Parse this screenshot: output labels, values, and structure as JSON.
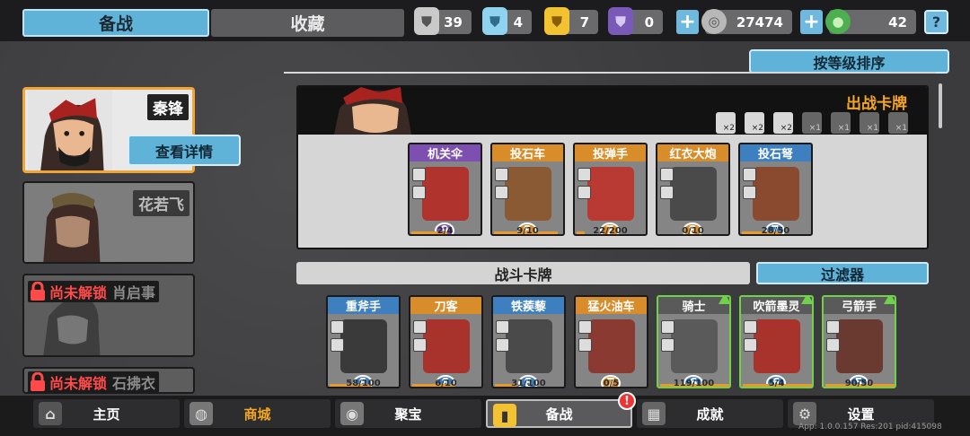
{
  "tabs": {
    "active": "备战",
    "inactive": "收藏"
  },
  "resources": [
    {
      "icon": "silver-shield-icon",
      "value": "39"
    },
    {
      "icon": "crystal-shield-icon",
      "value": "4"
    },
    {
      "icon": "gold-shield-icon",
      "value": "7"
    },
    {
      "icon": "purple-shield-icon",
      "value": "0"
    },
    {
      "icon": "coin-icon",
      "value": "27474"
    },
    {
      "icon": "gem-icon",
      "value": "42"
    }
  ],
  "help_label": "?",
  "sort_button": "按等级排序",
  "heroes": [
    {
      "name": "秦锋",
      "detail_button": "查看详情"
    },
    {
      "name": "花若飞"
    },
    {
      "lock_text": "尚未解锁",
      "name": "肖启事"
    },
    {
      "lock_text": "尚未解锁",
      "name": "石拂衣"
    }
  ],
  "deck": {
    "title": "出战卡牌",
    "tokens": [
      "×2",
      "×2",
      "×2",
      "×1",
      "×1",
      "×1",
      "×1"
    ],
    "cards": [
      {
        "name": "机关伞",
        "level": "9",
        "count": "2/4",
        "fill": 0.5
      },
      {
        "name": "投石车",
        "level": "8",
        "count": "9/10",
        "fill": 0.9
      },
      {
        "name": "投弹手",
        "level": "7",
        "count": "22/200",
        "fill": 0.11
      },
      {
        "name": "红衣大炮",
        "level": "8",
        "count": "0/10",
        "fill": 0
      },
      {
        "name": "投石弩",
        "level": "7",
        "count": "28/50",
        "fill": 0.56
      }
    ]
  },
  "battle_header": "战斗卡牌",
  "filter_button": "过滤器",
  "battle_cards": [
    {
      "name": "重斧手",
      "level": "8",
      "count": "58/100",
      "fill": 0.58
    },
    {
      "name": "刀客",
      "level": "8",
      "count": "6/10",
      "fill": 0.6
    },
    {
      "name": "铁蒺藜",
      "level": "8",
      "count": "31/100",
      "fill": 0.31
    },
    {
      "name": "猛火油车",
      "level": "7",
      "count": "0/5",
      "fill": 0
    },
    {
      "name": "骑士",
      "level": "6",
      "count": "119/100",
      "fill": 1
    },
    {
      "name": "吹箭墨灵",
      "level": "6",
      "count": "5/4",
      "fill": 1
    },
    {
      "name": "弓箭手",
      "level": "5",
      "count": "90/50",
      "fill": 1
    }
  ],
  "nav": [
    {
      "label": "主页",
      "icon": "home-icon"
    },
    {
      "label": "商城",
      "icon": "coins-icon"
    },
    {
      "label": "聚宝",
      "icon": "eye-icon"
    },
    {
      "label": "备战",
      "icon": "card-icon"
    },
    {
      "label": "成就",
      "icon": "grid-icon"
    },
    {
      "label": "设置",
      "icon": "gear-icon"
    }
  ],
  "nav_badge": "!",
  "version": "App: 1.0.0.157 Res:201 pid:415098"
}
